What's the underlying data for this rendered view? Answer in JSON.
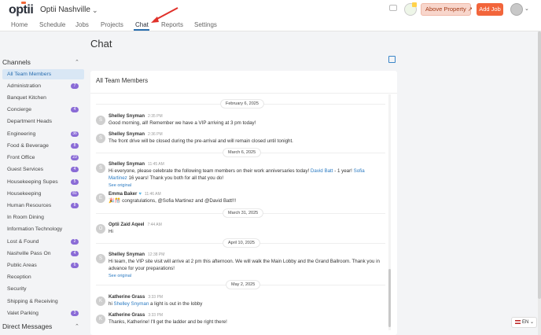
{
  "header": {
    "logo_text": "optii",
    "org_name": "Optii Nashville",
    "nav": [
      "Home",
      "Schedule",
      "Jobs",
      "Projects",
      "Chat",
      "Reports",
      "Settings"
    ],
    "active_nav": "Chat",
    "property_button": "Above Property",
    "add_job_button": "Add Job"
  },
  "page": {
    "title": "Chat"
  },
  "sidebar": {
    "channels_heading": "Channels",
    "dm_heading": "Direct Messages",
    "channels": [
      {
        "label": "All Team Members",
        "badge": ""
      },
      {
        "label": "Administration",
        "badge": "7"
      },
      {
        "label": "Banquet Kitchen",
        "badge": ""
      },
      {
        "label": "Concierge",
        "badge": "4"
      },
      {
        "label": "Department Heads",
        "badge": ""
      },
      {
        "label": "Engineering",
        "badge": "36"
      },
      {
        "label": "Food & Beverage",
        "badge": "8"
      },
      {
        "label": "Front Office",
        "badge": "23"
      },
      {
        "label": "Guest Services",
        "badge": "4"
      },
      {
        "label": "Housekeeping Supes",
        "badge": "5"
      },
      {
        "label": "Housekeeping",
        "badge": "81"
      },
      {
        "label": "Human Resources",
        "badge": "8"
      },
      {
        "label": "In Room Dining",
        "badge": ""
      },
      {
        "label": "Information Technology",
        "badge": ""
      },
      {
        "label": "Lost & Found",
        "badge": "2"
      },
      {
        "label": "Nashville Pass On",
        "badge": "4"
      },
      {
        "label": "Public Areas",
        "badge": "6"
      },
      {
        "label": "Reception",
        "badge": ""
      },
      {
        "label": "Security",
        "badge": ""
      },
      {
        "label": "Shipping & Receiving",
        "badge": ""
      },
      {
        "label": "Valet Parking",
        "badge": "3"
      }
    ]
  },
  "chat": {
    "channel_title": "All Team Members",
    "dates": [
      "February 6, 2025",
      "March 6, 2025",
      "March 31, 2025",
      "April 10, 2025",
      "May 2, 2025"
    ],
    "see_original": "See original",
    "messages": [
      {
        "initial": "S",
        "author": "Shelley Snyman",
        "time": "2:35 PM",
        "text": "Good morning, all! Remember we have a VIP arriving at 3 pm today!"
      },
      {
        "initial": "S",
        "author": "Shelley Snyman",
        "time": "2:36 PM",
        "text": "The front drive will be closed during the pre-arrival and will remain closed until tonight."
      },
      {
        "initial": "S",
        "author": "Shelley Snyman",
        "time": "11:45 AM",
        "text_a": "Hi everyone, please celebrate the following team members on their work anniversaries today! ",
        "mention_a": "David Batt",
        "text_b": " - 1 year! ",
        "mention_b": "Sofia Martinez",
        "text_c": " 16 years! Thank you both for all that you do!"
      },
      {
        "initial": "E",
        "author": "Emma Baker",
        "time": "11:46 AM",
        "text": "🎉🎊 congratulations, @Sofia Martinez and @David Batt!!!"
      },
      {
        "initial": "O",
        "author": "Optii Zaid Aqeel",
        "time": "7:44 AM",
        "text": "Hi"
      },
      {
        "initial": "S",
        "author": "Shelley Snyman",
        "time": "12:38 PM",
        "text": "Hi team, the VIP site visit will arrive at 2 pm this afternoon. We will walk the Main Lobby and the Grand Ballroom. Thank you in advance for your preparations!"
      },
      {
        "initial": "K",
        "author": "Katherine Grass",
        "time": "3:33 PM",
        "text_a": "hi ",
        "mention_a": "Shelley Snyman",
        "text_b": " a light is out in the lobby"
      },
      {
        "initial": "K",
        "author": "Katherine Grass",
        "time": "3:33 PM",
        "text": "Thanks, Katherine! I'll get the ladder and be right there!"
      }
    ]
  },
  "footer": {
    "language": "EN"
  }
}
